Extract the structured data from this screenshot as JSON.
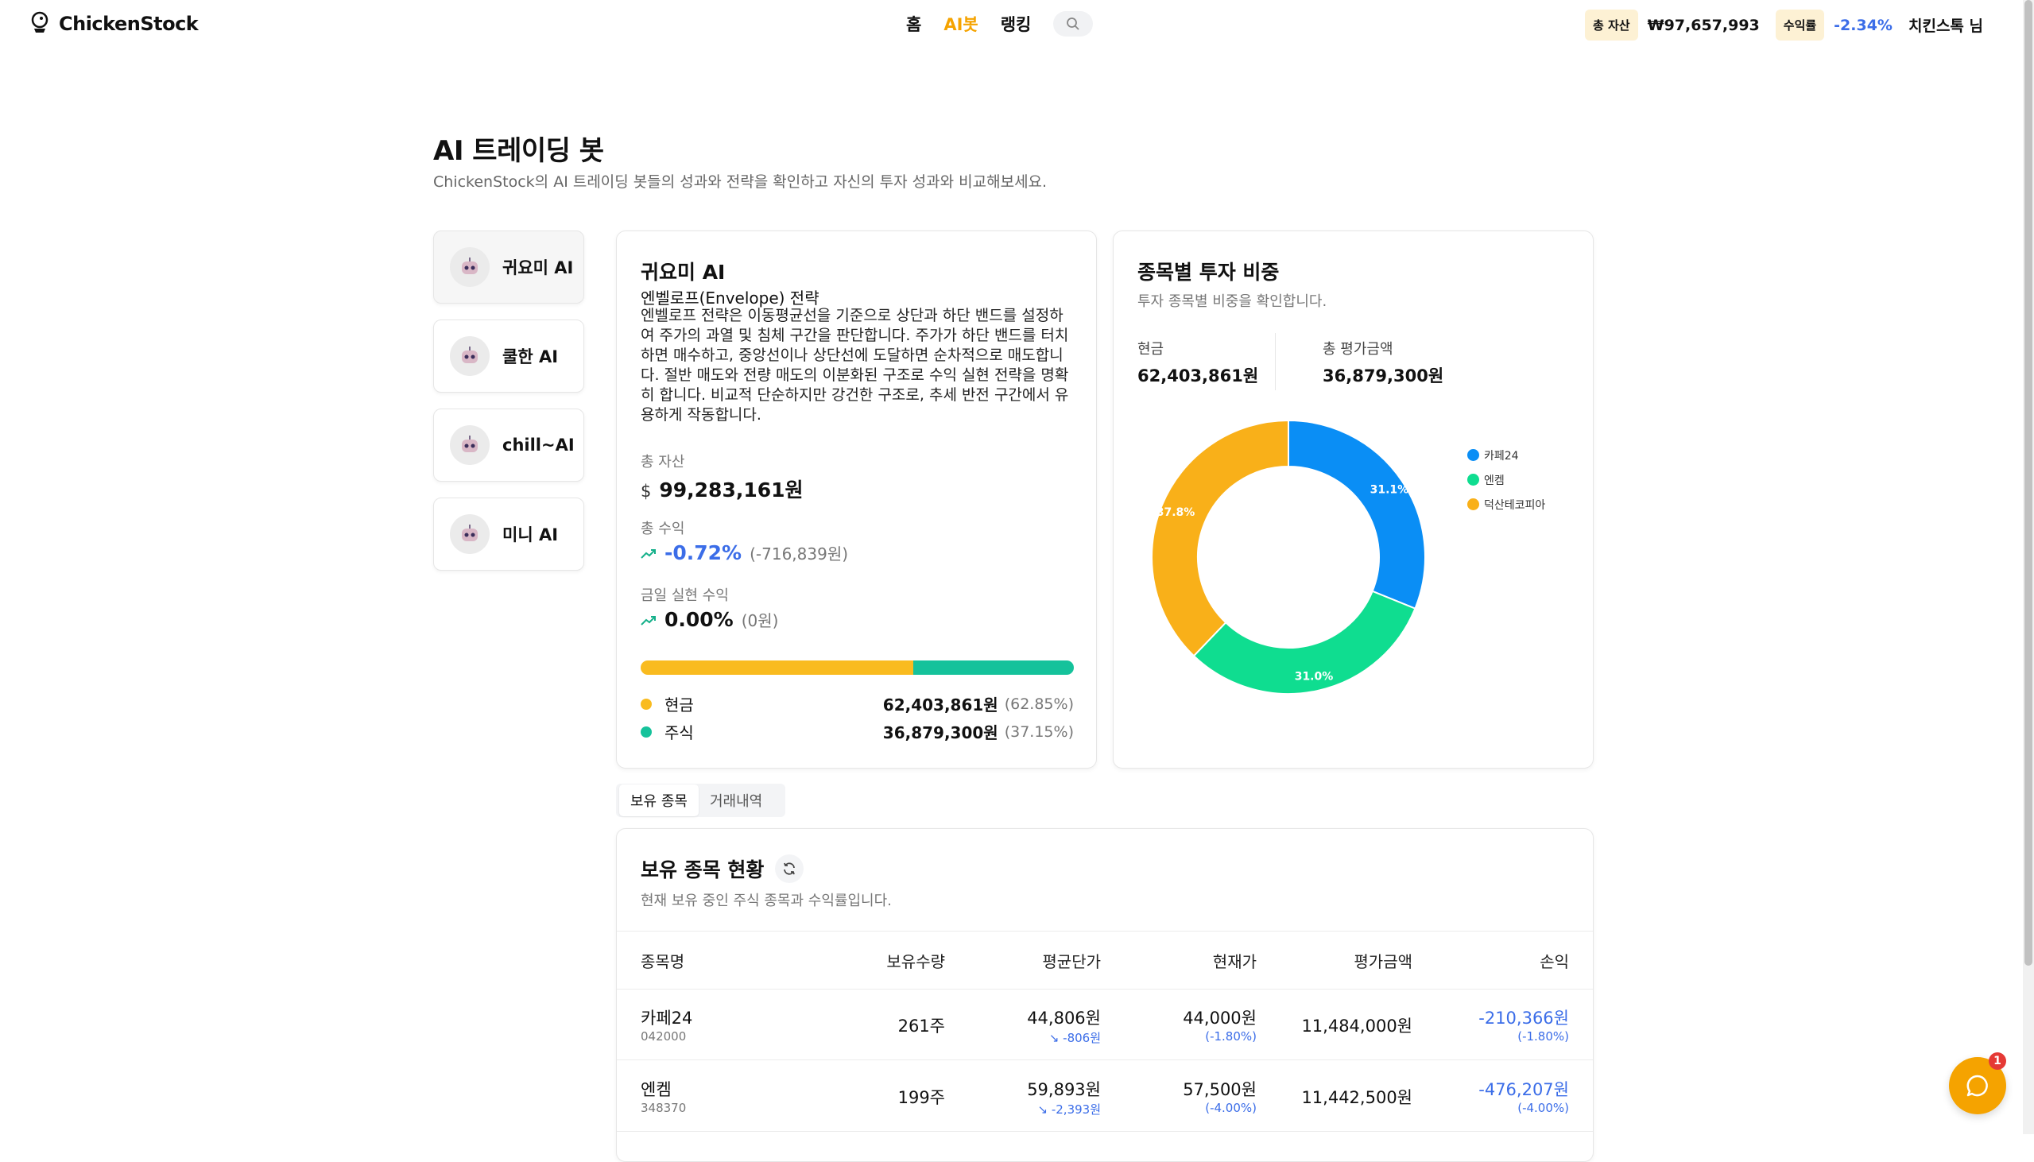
{
  "header": {
    "logo_text": "ChickenStock",
    "nav": {
      "home": "홈",
      "aibot": "AI봇",
      "ranking": "랭킹"
    },
    "total_assets_label": "총 자산",
    "total_assets_value": "₩97,657,993",
    "return_label": "수익률",
    "return_value": "-2.34%",
    "user": "치킨스톡 님"
  },
  "page": {
    "title": "AI 트레이딩 봇",
    "subtitle": "ChickenStock의 AI 트레이딩 봇들의 성과와 전략을 확인하고 자신의 투자 성과와 비교해보세요."
  },
  "bots": [
    {
      "name": "귀요미 AI"
    },
    {
      "name": "쿨한 AI"
    },
    {
      "name": "chill~AI"
    },
    {
      "name": "미니 AI"
    }
  ],
  "bot_detail": {
    "title": "귀요미 AI",
    "strategy_name": "엔벨로프(Envelope) 전략",
    "strategy_desc": "엔벨로프 전략은 이동평균선을 기준으로 상단과 하단 밴드를 설정하여 주가의 과열 및 침체 구간을 판단합니다. 주가가 하단 밴드를 터치하면 매수하고, 중앙선이나 상단선에 도달하면 순차적으로 매도합니다. 절반 매도와 전량 매도의 이분화된 구조로 수익 실현 전략을 명확히 합니다. 비교적 단순하지만 강건한 구조로, 추세 반전 구간에서 유용하게 작동합니다.",
    "total_assets_label": "총 자산",
    "total_assets_value": "99,283,161원",
    "total_profit_label": "총 수익",
    "total_profit_pct": "-0.72%",
    "total_profit_amount": "(-716,839원)",
    "today_profit_label": "금일 실현 수익",
    "today_profit_pct": "0.00%",
    "today_profit_amount": "(0원)",
    "cash_ratio": 0.6285,
    "cash_label": "현금",
    "cash_value": "62,403,861원",
    "cash_pct": "(62.85%)",
    "stock_label": "주식",
    "stock_value": "36,879,300원",
    "stock_pct": "(37.15%)",
    "colors": {
      "cash": "#f9bb1f",
      "stock": "#15c29b"
    }
  },
  "allocation": {
    "title": "종목별 투자 비중",
    "subtitle": "투자 종목별 비중을 확인합니다.",
    "cash_label": "현금",
    "cash_value": "62,403,861원",
    "eval_label": "총 평가금액",
    "eval_value": "36,879,300원"
  },
  "chart_data": {
    "type": "pie",
    "categories": [
      "카페24",
      "엔켐",
      "덕산테코피아"
    ],
    "values": [
      31.1,
      31.0,
      37.8
    ],
    "labels": [
      "31.1%",
      "31.0%",
      "37.8%"
    ],
    "colors": [
      "#0a8ef5",
      "#0fdd90",
      "#f9b019"
    ],
    "legend": "right"
  },
  "tabs": {
    "holdings": "보유 종목",
    "history": "거래내역"
  },
  "holdings": {
    "title": "보유 종목 현황",
    "subtitle": "현재 보유 중인 주식 종목과 수익률입니다.",
    "columns": [
      "종목명",
      "보유수량",
      "평균단가",
      "현재가",
      "평가금액",
      "손익"
    ],
    "rows": [
      {
        "name": "카페24",
        "code": "042000",
        "qty": "261주",
        "avg": "44,806원",
        "avg_diff": "-806원",
        "price": "44,000원",
        "price_pct": "(-1.80%)",
        "eval": "11,484,000원",
        "pl": "-210,366원",
        "pl_pct": "(-1.80%)"
      },
      {
        "name": "엔켐",
        "code": "348370",
        "qty": "199주",
        "avg": "59,893원",
        "avg_diff": "-2,393원",
        "price": "57,500원",
        "price_pct": "(-4.00%)",
        "eval": "11,442,500원",
        "pl": "-476,207원",
        "pl_pct": "(-4.00%)"
      }
    ]
  },
  "chat": {
    "badge": "1"
  }
}
